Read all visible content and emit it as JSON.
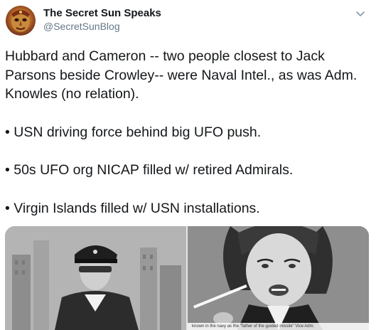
{
  "tweet": {
    "author": {
      "display_name": "The Secret Sun Speaks",
      "handle": "@SecretSunBlog",
      "avatar_icon": "mask-avatar-icon"
    },
    "menu_icon": "chevron-down-icon",
    "paragraphs": [
      "Hubbard and Cameron -- two people closest to Jack Parsons beside Crowley-- were Naval Intel., as was Adm. Knowles (no relation).",
      "• USN driving force behind big UFO push.",
      "• 50s UFO org NICAP filled w/ retired Admirals.",
      "• Virgin Islands filled w/ USN installations."
    ],
    "media": {
      "photos": [
        {
          "icon": "navy-officer-photo"
        },
        {
          "icon": "woman-smoking-photo",
          "caption": "known in the navy as the \"father of the guided missile\" Vice Adm."
        }
      ]
    }
  },
  "colors": {
    "text": "#14171a",
    "secondary_text": "#657786",
    "background": "#ffffff"
  }
}
